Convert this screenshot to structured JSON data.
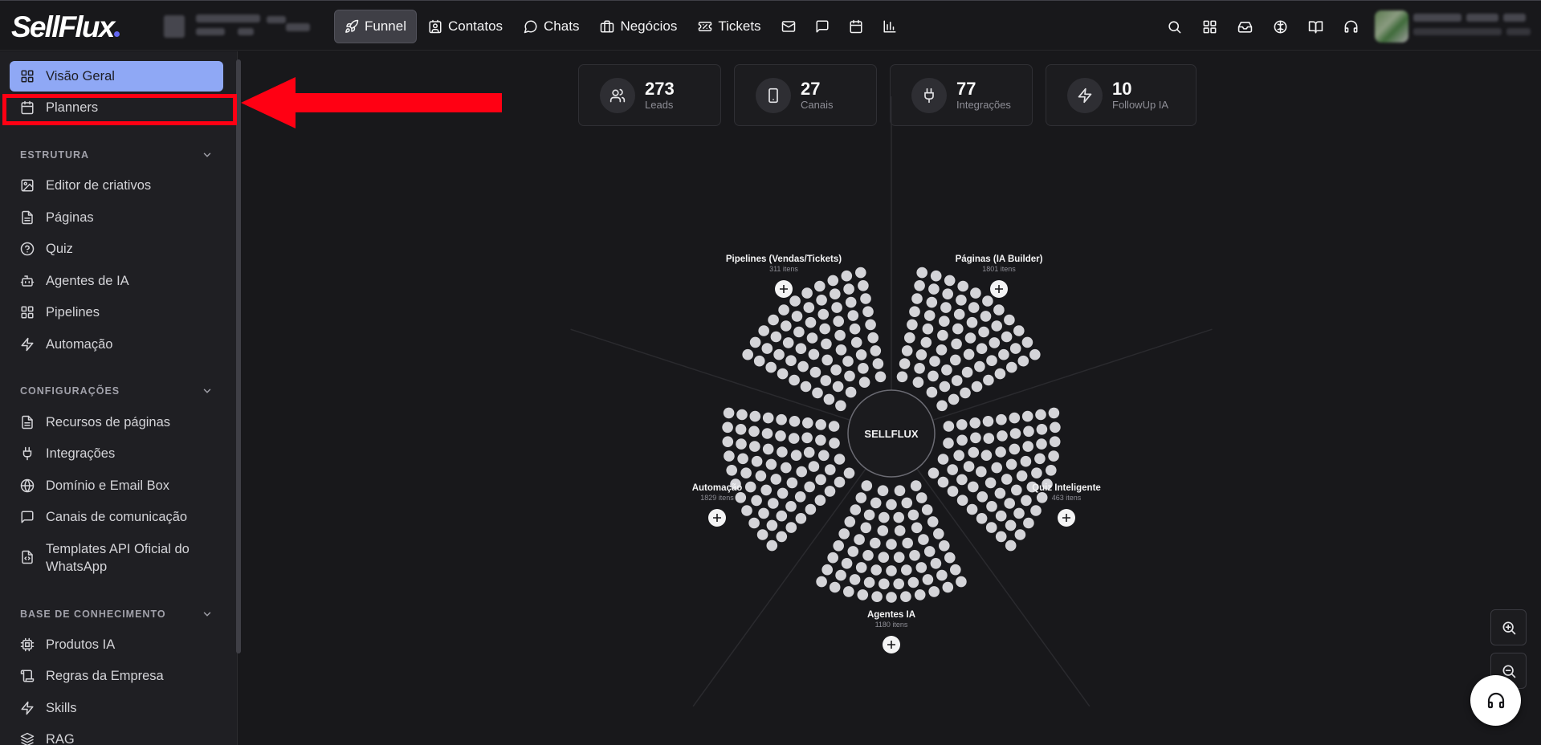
{
  "app": {
    "logo_text": "SellFlux"
  },
  "nav": {
    "items": [
      {
        "label": "Funnel",
        "icon": "rocket-icon",
        "active": true
      },
      {
        "label": "Contatos",
        "icon": "contact-card-icon"
      },
      {
        "label": "Chats",
        "icon": "chat-bubble-icon"
      },
      {
        "label": "Negócios",
        "icon": "briefcase-icon"
      },
      {
        "label": "Tickets",
        "icon": "ticket-icon"
      }
    ],
    "icon_buttons": [
      "mail-icon",
      "message-square-icon",
      "calendar-icon",
      "bar-chart-icon"
    ],
    "right_icons": [
      "search-icon",
      "apps-grid-icon",
      "inbox-icon",
      "brain-icon",
      "book-icon",
      "headset-icon"
    ]
  },
  "sidebar": {
    "top_items": [
      {
        "label": "Visão Geral",
        "icon": "layout-grid-icon",
        "active": true
      },
      {
        "label": "Planners",
        "icon": "calendar-icon"
      }
    ],
    "sections": [
      {
        "title": "ESTRUTURA",
        "items": [
          {
            "label": "Editor de criativos",
            "icon": "image-edit-icon"
          },
          {
            "label": "Páginas",
            "icon": "file-text-icon"
          },
          {
            "label": "Quiz",
            "icon": "help-circle-icon"
          },
          {
            "label": "Agentes de IA",
            "icon": "bot-icon"
          },
          {
            "label": "Pipelines",
            "icon": "layout-grid-icon"
          },
          {
            "label": "Automação",
            "icon": "zap-icon"
          }
        ]
      },
      {
        "title": "CONFIGURAÇÕES",
        "items": [
          {
            "label": "Recursos de páginas",
            "icon": "file-text-icon"
          },
          {
            "label": "Integrações",
            "icon": "plug-icon"
          },
          {
            "label": "Domínio e Email Box",
            "icon": "globe-icon"
          },
          {
            "label": "Canais de comunicação",
            "icon": "message-square-icon"
          },
          {
            "label_line1": "Templates API Oficial do",
            "label_line2": "WhatsApp",
            "icon": "file-code-icon"
          }
        ]
      },
      {
        "title": "BASE DE CONHECIMENTO",
        "items": [
          {
            "label": "Produtos IA",
            "icon": "cpu-icon"
          },
          {
            "label": "Regras da Empresa",
            "icon": "scroll-icon"
          },
          {
            "label": "Skills",
            "icon": "zap-icon"
          },
          {
            "label": "RAG",
            "icon": "layers-icon"
          }
        ]
      }
    ]
  },
  "stats": [
    {
      "value": "273",
      "label": "Leads",
      "icon": "users-icon"
    },
    {
      "value": "27",
      "label": "Canais",
      "icon": "smartphone-icon"
    },
    {
      "value": "77",
      "label": "Integrações",
      "icon": "plug-icon"
    },
    {
      "value": "10",
      "label": "FollowUp IA",
      "icon": "zap-icon"
    }
  ],
  "funnel": {
    "center_label": "SELLFLUX",
    "groups": [
      {
        "name": "Pipelines (Vendas/Tickets)",
        "count": "311 itens"
      },
      {
        "name": "Páginas (IA Builder)",
        "count": "1801 itens"
      },
      {
        "name": "Quiz Inteligente",
        "count": "463 itens"
      },
      {
        "name": "Agentes IA",
        "count": "1180 itens"
      },
      {
        "name": "Automação",
        "count": "1829 itens"
      }
    ]
  },
  "colors": {
    "accent": "#8fa8f5",
    "highlight_red": "#ff0013",
    "background": "#18181b",
    "node": "#d4d4d8"
  }
}
